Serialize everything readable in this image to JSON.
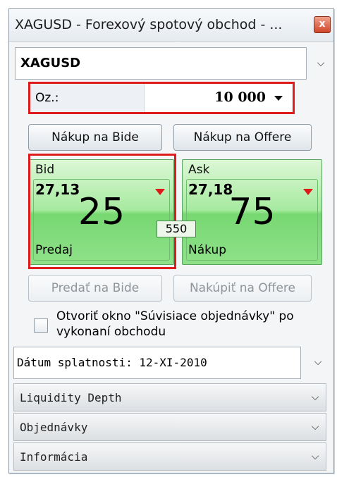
{
  "window": {
    "title": "XAGUSD - Forexový spotový obchod - ...",
    "close_label": "x"
  },
  "symbol": {
    "value": "XAGUSD"
  },
  "quantity": {
    "label": "Oz.:",
    "value": "10 000"
  },
  "buttons": {
    "buy_on_bid": "Nákup na Bide",
    "buy_on_offer": "Nákup na Offere",
    "sell_on_bid": "Predať na Bide",
    "buy_on_offer_disabled": "Nakúpiť na Offere"
  },
  "bid": {
    "label": "Bid",
    "big_figure": "27,13",
    "pips": "25",
    "action": "Predaj"
  },
  "ask": {
    "label": "Ask",
    "big_figure": "27,18",
    "pips": "75",
    "action": "Nákup"
  },
  "spread": "550",
  "checkbox": {
    "label": "Otvoriť okno \"Súvisiace objednávky\" po vykonaní obchodu",
    "checked": false
  },
  "settlement": {
    "value": "Dátum splatnosti: 12-XI-2010"
  },
  "sections": {
    "liquidity": "Liquidity Depth",
    "orders": "Objednávky",
    "info": "Informácia"
  },
  "colors": {
    "highlight": "#e01b1b",
    "tile_green": "#8fe189",
    "down_arrow": "#de1a1a"
  },
  "icons": {
    "close": "close-icon",
    "dropdown": "chevron-down-icon",
    "price_down": "triangle-down-icon"
  }
}
